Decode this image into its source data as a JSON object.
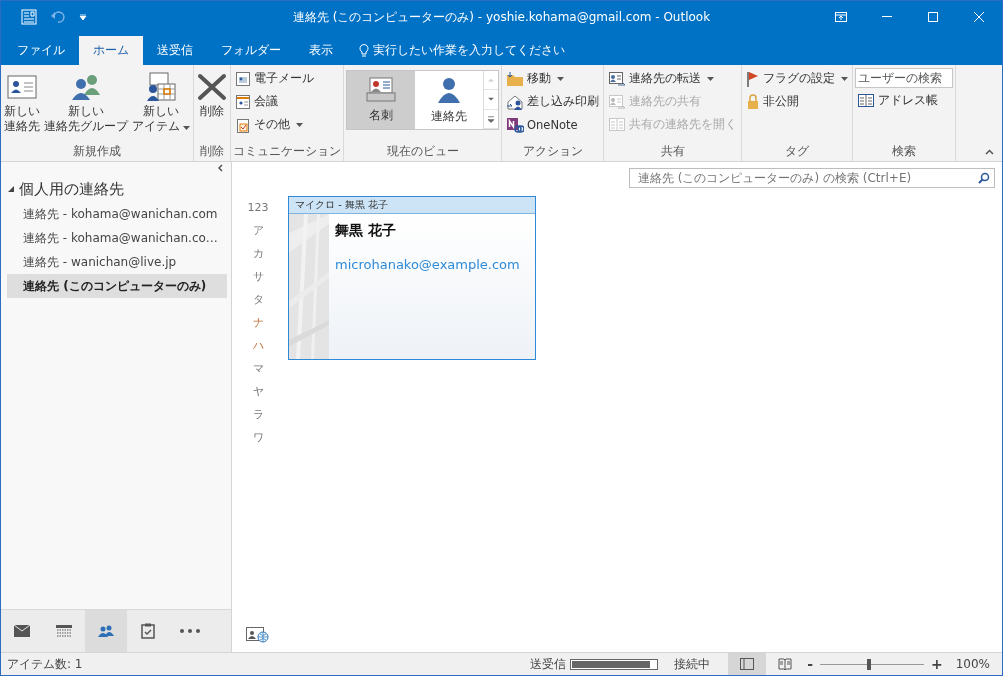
{
  "window": {
    "title": "連絡先 (このコンピューターのみ) - yoshie.kohama@gmail.com - Outlook"
  },
  "tabs": [
    {
      "label": "ファイル",
      "selected": false
    },
    {
      "label": "ホーム",
      "selected": true
    },
    {
      "label": "送受信",
      "selected": false
    },
    {
      "label": "フォルダー",
      "selected": false
    },
    {
      "label": "表示",
      "selected": false
    }
  ],
  "tell_me": {
    "placeholder": "実行したい作業を入力してください"
  },
  "ribbon": {
    "groups": [
      {
        "label": "新規作成",
        "items": [
          {
            "kind": "large",
            "lines": [
              "新しい",
              "連絡先"
            ],
            "dropdown": false,
            "disabled": false
          },
          {
            "kind": "large",
            "lines": [
              "新しい",
              "連絡先グループ"
            ],
            "dropdown": false,
            "disabled": false
          },
          {
            "kind": "large",
            "lines": [
              "新しい",
              "アイテム"
            ],
            "dropdown": true,
            "disabled": false
          }
        ]
      },
      {
        "label": "削除",
        "items": [
          {
            "kind": "large",
            "lines": [
              "削除"
            ],
            "dropdown": false,
            "disabled": false
          }
        ]
      },
      {
        "label": "コミュニケーション",
        "items": [
          {
            "kind": "small",
            "lines": [
              "電子メール"
            ],
            "dropdown": false,
            "disabled": false
          },
          {
            "kind": "small",
            "lines": [
              "会議"
            ],
            "dropdown": false,
            "disabled": false
          },
          {
            "kind": "small",
            "lines": [
              "その他"
            ],
            "dropdown": true,
            "disabled": false
          }
        ]
      },
      {
        "label": "現在のビュー",
        "items": [
          {
            "kind": "view",
            "lines": [
              "名刺"
            ],
            "selected": true
          },
          {
            "kind": "view",
            "lines": [
              "連絡先"
            ],
            "selected": false
          }
        ]
      },
      {
        "label": "アクション",
        "items": [
          {
            "kind": "small",
            "lines": [
              "移動"
            ],
            "dropdown": true,
            "disabled": false
          },
          {
            "kind": "small",
            "lines": [
              "差し込み印刷"
            ],
            "dropdown": false,
            "disabled": false
          },
          {
            "kind": "small",
            "lines": [
              "OneNote"
            ],
            "dropdown": false,
            "disabled": false
          }
        ]
      },
      {
        "label": "共有",
        "items": [
          {
            "kind": "small",
            "lines": [
              "連絡先の転送"
            ],
            "dropdown": true,
            "disabled": false
          },
          {
            "kind": "small",
            "lines": [
              "連絡先の共有"
            ],
            "dropdown": false,
            "disabled": true
          },
          {
            "kind": "small",
            "lines": [
              "共有の連絡先を開く"
            ],
            "dropdown": false,
            "disabled": true
          }
        ]
      },
      {
        "label": "タグ",
        "items": [
          {
            "kind": "small",
            "lines": [
              "フラグの設定"
            ],
            "dropdown": true,
            "disabled": false
          },
          {
            "kind": "small",
            "lines": [
              "非公開"
            ],
            "dropdown": false,
            "disabled": false
          }
        ]
      },
      {
        "label": "検索",
        "items": [
          {
            "kind": "search",
            "placeholder": "ユーザーの検索"
          },
          {
            "kind": "small",
            "lines": [
              "アドレス帳"
            ],
            "dropdown": false,
            "disabled": false
          }
        ]
      }
    ]
  },
  "sidebar": {
    "folders": [
      {
        "label": "個人用の連絡先",
        "expanded": true,
        "children": [
          {
            "label": "連絡先 - kohama@wanichan.com",
            "selected": false
          },
          {
            "label": "連絡先 - kohama@wanichan.co…",
            "selected": false
          },
          {
            "label": "連絡先 - wanichan@live.jp",
            "selected": false
          },
          {
            "label": "連絡先 (このコンピューターのみ)",
            "selected": true
          }
        ]
      }
    ],
    "nav": [
      {
        "selected": false
      },
      {
        "selected": false
      },
      {
        "selected": true
      },
      {
        "selected": false
      },
      {
        "selected": false
      }
    ]
  },
  "search": {
    "placeholder": "連絡先 (このコンピューターのみ) の検索 (Ctrl+E)"
  },
  "index": [
    {
      "label": "123",
      "highlighted": false
    },
    {
      "label": "ア",
      "highlighted": false
    },
    {
      "label": "カ",
      "highlighted": false
    },
    {
      "label": "サ",
      "highlighted": false
    },
    {
      "label": "タ",
      "highlighted": false
    },
    {
      "label": "ナ",
      "highlighted": true
    },
    {
      "label": "ハ",
      "highlighted": true
    },
    {
      "label": "マ",
      "highlighted": false
    },
    {
      "label": "ヤ",
      "highlighted": false
    },
    {
      "label": "ラ",
      "highlighted": false
    },
    {
      "label": "ワ",
      "highlighted": false
    }
  ],
  "cards": [
    {
      "file_as": "マイクロ - 舞黒 花子",
      "name": "舞黒 花子",
      "email": "microhanako@example.com",
      "selected": true
    }
  ],
  "status_bar": {
    "items": "アイテム数: 1",
    "send_receive": "送受信",
    "progress": {
      "level": 0.93
    },
    "connection": "接続中",
    "zoom": {
      "minus": "-",
      "level": 0.47,
      "plus": "+",
      "percent": "100%"
    }
  }
}
